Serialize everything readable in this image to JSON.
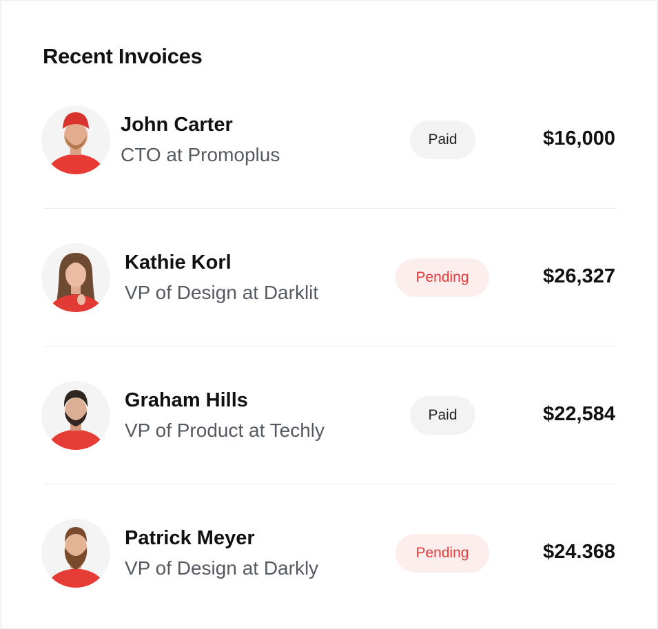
{
  "card": {
    "title": "Recent Invoices"
  },
  "invoices": [
    {
      "name": "John Carter",
      "role": "CTO at Promoplus",
      "status": "Paid",
      "status_type": "paid",
      "amount": "$16,000",
      "avatar_icon": "person-avatar-icon"
    },
    {
      "name": "Kathie Korl",
      "role": "VP of Design at Darklit",
      "status": "Pending",
      "status_type": "pending",
      "amount": "$26,327",
      "avatar_icon": "person-avatar-icon"
    },
    {
      "name": "Graham Hills",
      "role": "VP of Product at Techly",
      "status": "Paid",
      "status_type": "paid",
      "amount": "$22,584",
      "avatar_icon": "person-avatar-icon"
    },
    {
      "name": "Patrick Meyer",
      "role": "VP of Design at Darkly",
      "status": "Pending",
      "status_type": "pending",
      "amount": "$24.368",
      "avatar_icon": "person-avatar-icon"
    }
  ],
  "colors": {
    "accent_red": "#e43a3a",
    "pending_bg": "#fdeeee",
    "paid_bg": "#f3f3f3"
  }
}
